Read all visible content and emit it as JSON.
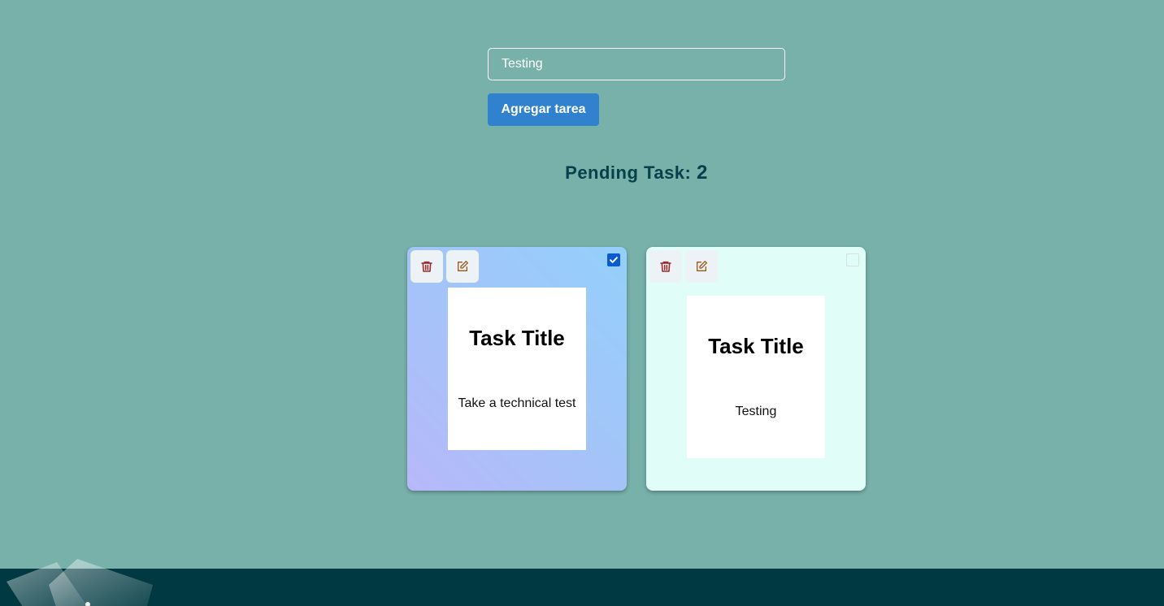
{
  "form": {
    "input_value": "Testing",
    "submit_label": "Agregar tarea"
  },
  "pending": {
    "label": "Pending Task: ",
    "count": "2"
  },
  "tasks": [
    {
      "title": "Task Title",
      "description": "Take a technical test",
      "done": true
    },
    {
      "title": "Task Title",
      "description": "Testing",
      "done": false
    }
  ],
  "colors": {
    "background": "#78b0aa",
    "button": "#3182ce",
    "footer": "#003941",
    "delete_icon": "#9b2c2c",
    "edit_icon": "#975a16",
    "heading": "#06414a"
  },
  "icons": {
    "delete": "trash-icon",
    "edit": "edit-icon",
    "done": "checkbox-icon"
  }
}
